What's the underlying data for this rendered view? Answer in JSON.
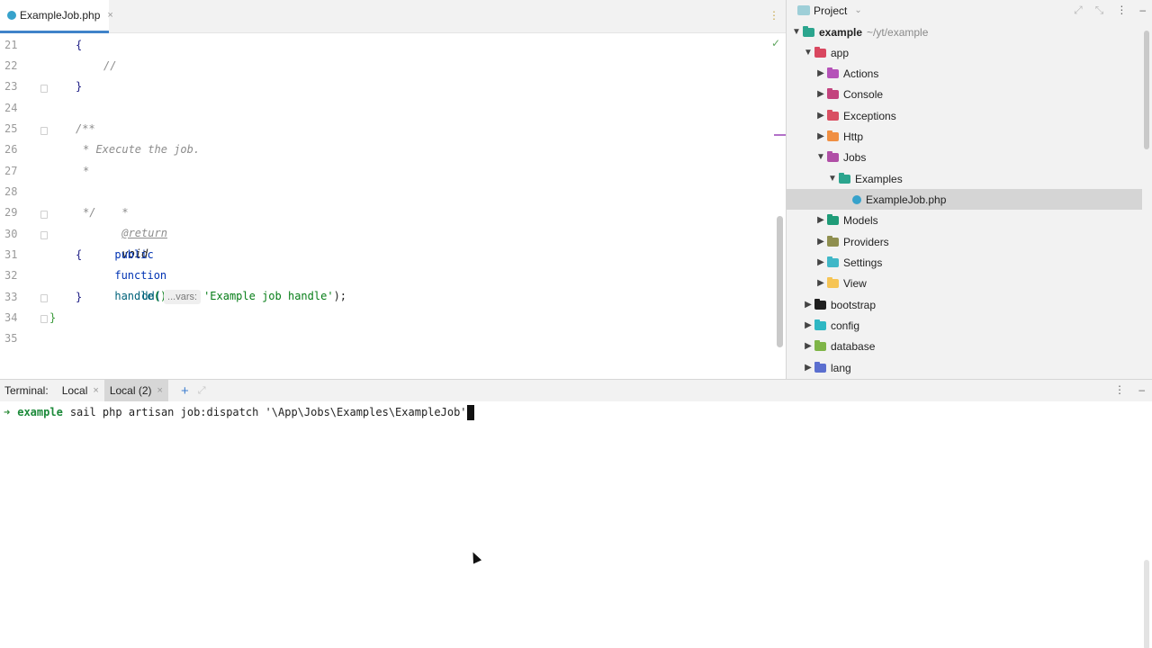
{
  "editor": {
    "tab": {
      "label": "ExampleJob.php",
      "close": "×"
    },
    "tab_menu": "⋮",
    "inspection_ok": "✓",
    "line_numbers": [
      "21",
      "22",
      "23",
      "24",
      "25",
      "26",
      "27",
      "28",
      "29",
      "30",
      "31",
      "32",
      "33",
      "34",
      "35"
    ],
    "code": {
      "l21": "{",
      "l22": "//",
      "l23": "}",
      "l25": "/**",
      "l26": "* Execute the job.",
      "l27": "*",
      "l28_star": "*",
      "l28_tag": "@return",
      "l28_type": "void",
      "l29": "*/",
      "l30_public": "public",
      "l30_function": "function",
      "l30_name": "handle",
      "l30_parens": "()",
      "l31": "{",
      "l32_call": "dd(",
      "l32_hint": "...vars:",
      "l32_string": "'Example job handle'",
      "l32_end": ");",
      "l33": "}",
      "l34": "}"
    }
  },
  "project": {
    "title": "Project",
    "caret": "⌄",
    "root": {
      "name": "example",
      "path": "~/yt/example"
    },
    "items": [
      {
        "label": "app",
        "expanded": true
      },
      {
        "label": "Actions"
      },
      {
        "label": "Console"
      },
      {
        "label": "Exceptions"
      },
      {
        "label": "Http"
      },
      {
        "label": "Jobs",
        "expanded": true
      },
      {
        "label": "Examples",
        "expanded": true
      },
      {
        "label": "ExampleJob.php",
        "selected": true
      },
      {
        "label": "Models"
      },
      {
        "label": "Providers"
      },
      {
        "label": "Settings"
      },
      {
        "label": "View"
      },
      {
        "label": "bootstrap"
      },
      {
        "label": "config"
      },
      {
        "label": "database"
      },
      {
        "label": "lang"
      }
    ],
    "colors": {
      "app": "#d9475f",
      "actions": "#b552b8",
      "console": "#c3437e",
      "exceptions": "#d94f62",
      "http": "#f08f42",
      "jobs": "#b04fa6",
      "examples": "#2ba58e",
      "models": "#1f9c78",
      "providers": "#8f8f4f",
      "settings": "#40b7c7",
      "view": "#f6c454",
      "bootstrap": "#1f1f1f",
      "config": "#2fb7c3",
      "database": "#7fb548",
      "lang": "#5b6fcf"
    }
  },
  "terminal": {
    "label": "Terminal:",
    "tabs": [
      {
        "label": "Local",
        "active": false
      },
      {
        "label": "Local (2)",
        "active": true
      }
    ],
    "close": "×",
    "add": "+",
    "menu": "⋮",
    "minimize": "–",
    "prompt_arrow": "➜",
    "prompt_dir": "example",
    "command": "sail php artisan job:dispatch '\\App\\Jobs\\Examples\\ExampleJob'"
  }
}
